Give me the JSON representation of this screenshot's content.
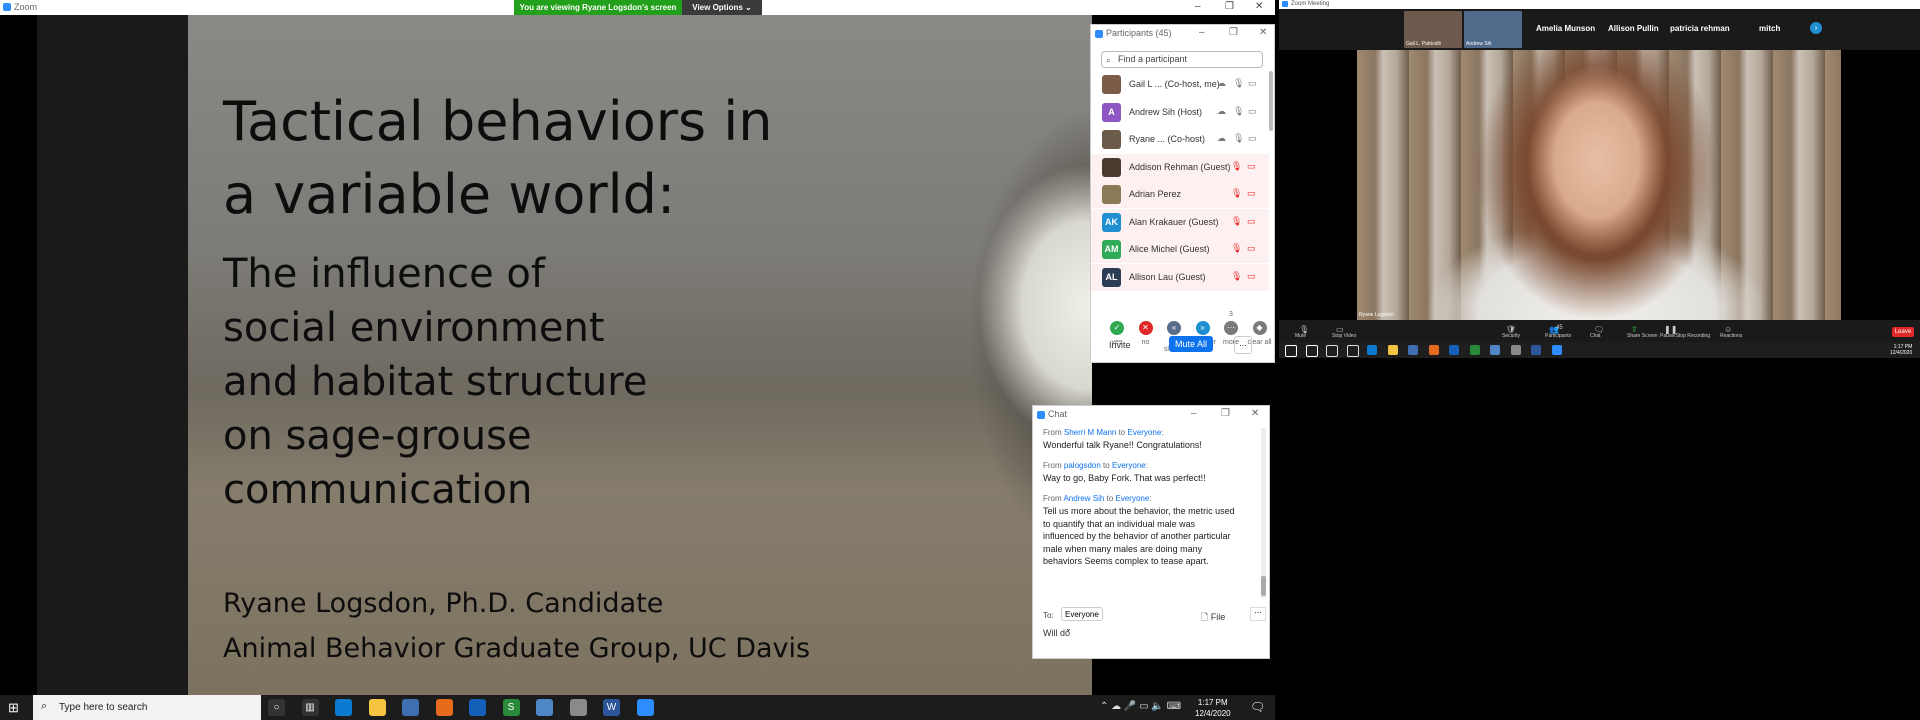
{
  "left_window": {
    "app_title": "Zoom",
    "share_banner": "You are viewing Ryane Logsdon's screen",
    "view_options_label": "View Options",
    "controls": {
      "minimize": "–",
      "restore": "❐",
      "close": "✕"
    }
  },
  "slide": {
    "title": "Tactical behaviors in\na variable world:",
    "subtitle": "The influence of\nsocial environment\nand habitat structure\non sage-grouse\ncommunication",
    "author": "Ryane Logsdon, Ph.D. Candidate",
    "affiliation": "Animal Behavior Graduate Group, UC Davis"
  },
  "participants": {
    "header": "Participants (45)",
    "search_placeholder": "Find a participant",
    "rows": [
      {
        "name": "Gail L ...  (Co-host, me)",
        "avatar_text": "",
        "avatar_color": "#7a5c48",
        "muted": false
      },
      {
        "name": "Andrew Sih (Host)",
        "avatar_text": "A",
        "avatar_color": "#8e56c2",
        "muted": false
      },
      {
        "name": "Ryane ...  (Co-host)",
        "avatar_text": "",
        "avatar_color": "#6c5a4a",
        "muted": false
      },
      {
        "name": "Addison Rehman (Guest)",
        "avatar_text": "",
        "avatar_color": "#4a3a30",
        "muted": true
      },
      {
        "name": "Adrian Perez",
        "avatar_text": "",
        "avatar_color": "#8a7a55",
        "muted": true
      },
      {
        "name": "Alan Krakauer (Guest)",
        "avatar_text": "AK",
        "avatar_color": "#1f8fd1",
        "muted": true
      },
      {
        "name": "Alice Michel (Guest)",
        "avatar_text": "AM",
        "avatar_color": "#2faa56",
        "muted": true
      },
      {
        "name": "Allison Lau (Guest)",
        "avatar_text": "AL",
        "avatar_color": "#2b3d55",
        "muted": true
      }
    ],
    "reactions": [
      {
        "label": "yes",
        "color": "#2fa84f",
        "glyph": "✓"
      },
      {
        "label": "no",
        "color": "#e02828",
        "glyph": "✕"
      },
      {
        "label": "go slower",
        "color": "#5b6b8a",
        "glyph": "«"
      },
      {
        "label": "go faster",
        "color": "#1f8fd1",
        "glyph": "»"
      },
      {
        "label": "more",
        "color": "#7a7a7a",
        "glyph": "⋯",
        "count": "3"
      },
      {
        "label": "clear all",
        "color": "#7a7a7a",
        "glyph": "◆"
      }
    ],
    "invite_label": "Invite",
    "mute_all_label": "Mute All",
    "more_label": "..."
  },
  "chat": {
    "title": "Chat",
    "messages": [
      {
        "prefix": "From ",
        "sender": "Sherri M Mann",
        "to_word": " to ",
        "to": "Everyone",
        "colon": ":",
        "text": "Wonderful talk Ryane!!  Congratulations!"
      },
      {
        "prefix": "From ",
        "sender": "palogsdon",
        "to_word": " to ",
        "to": "Everyone",
        "colon": ":",
        "text": "Way to go, Baby Fork. That was perfect!!"
      },
      {
        "prefix": "From ",
        "sender": "Andrew Sih",
        "to_word": " to ",
        "to": "Everyone",
        "colon": ":",
        "text": "Tell us more about the behavior, the metric used to quantify that an individual male was influenced by the behavior of another particular male when many males are doing many behaviors  Seems complex to tease apart."
      }
    ],
    "to_label": "To:",
    "to_value": "Everyone",
    "file_label": "File",
    "input_value": "Will do"
  },
  "taskbar": {
    "search_placeholder": "Type here to search",
    "time": "1:17 PM",
    "date": "12/4/2020",
    "pinned_icons": [
      "cortana-icon",
      "task-view-icon",
      "edge-icon",
      "file-explorer-icon",
      "app-icon",
      "firefox-icon",
      "outlook-icon",
      "app-s-icon",
      "app-window-icon",
      "app-files-icon",
      "word-icon",
      "zoom-icon"
    ]
  },
  "right_monitor": {
    "title": "Zoom Meeting",
    "thumbnails": [
      {
        "caption": "Gail L. Patricelli"
      },
      {
        "caption": "Andrew Sih"
      }
    ],
    "names": [
      "Amelia Munson",
      "Allison Pullin",
      "patricia rehman",
      "mitch"
    ],
    "video_caption": "Ryane Logsdon",
    "toolbar": [
      "Mute",
      "Stop Video",
      "Security",
      "Participants",
      "Chat",
      "Share Screen",
      "Pause/Stop Recording",
      "Reactions"
    ],
    "participant_count": "45",
    "leave_label": "Leave",
    "time": "1:17 PM",
    "date": "12/4/2020"
  }
}
